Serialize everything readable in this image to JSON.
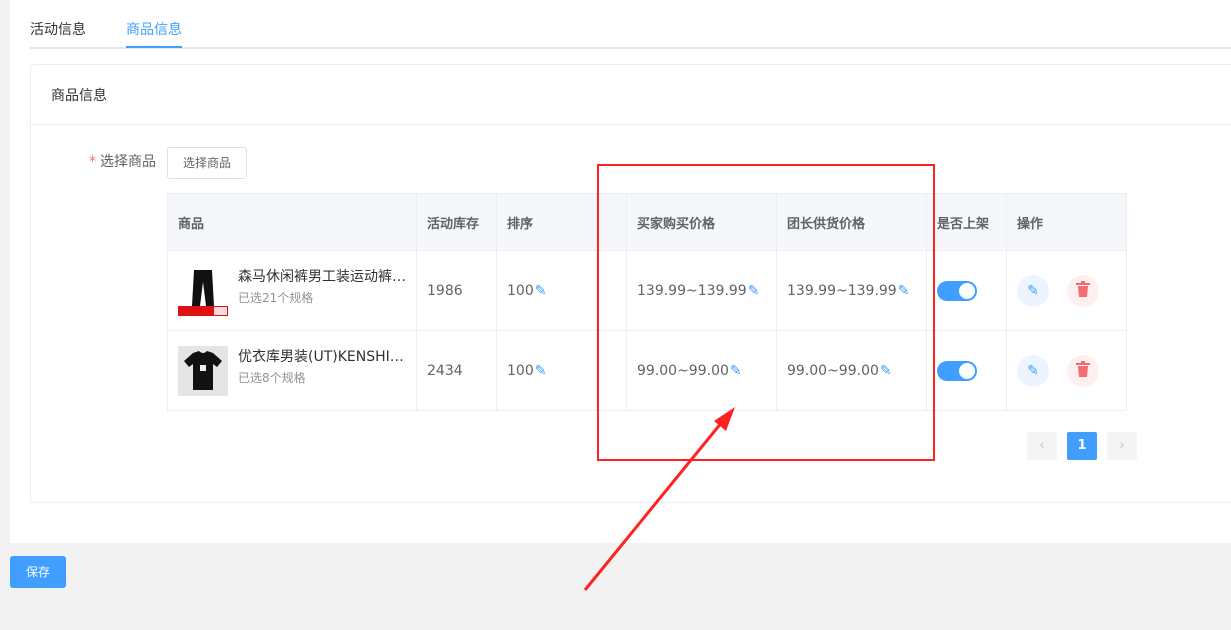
{
  "tabs": [
    {
      "label": "活动信息",
      "active": false
    },
    {
      "label": "商品信息",
      "active": true
    }
  ],
  "card": {
    "title": "商品信息"
  },
  "form": {
    "required_mark": "*",
    "label": "选择商品",
    "select_button": "选择商品"
  },
  "table": {
    "headers": [
      "商品",
      "活动库存",
      "排序",
      "",
      "买家购买价格",
      "团长供货价格",
      "是否上架",
      "操作"
    ],
    "rows": [
      {
        "name": "森马休闲裤男工装运动裤潮流百搭",
        "spec": "已选21个规格",
        "stock": "1986",
        "sort": "100",
        "buyer_price": "139.99~139.99",
        "leader_price": "139.99~139.99",
        "on_shelf": true
      },
      {
        "name": "优衣库男装(UT)KENSHI YONEZAWA印花T恤",
        "spec": "已选8个规格",
        "stock": "2434",
        "sort": "100",
        "buyer_price": "99.00~99.00",
        "leader_price": "99.00~99.00",
        "on_shelf": true
      }
    ]
  },
  "pagination": {
    "current": "1"
  },
  "save_label": "保存",
  "colors": {
    "primary": "#409eff",
    "danger": "#f56c6c",
    "annotation": "#ff2222"
  },
  "icons": [
    "pencil-icon",
    "trash-icon",
    "chevron-left-icon",
    "chevron-right-icon"
  ]
}
